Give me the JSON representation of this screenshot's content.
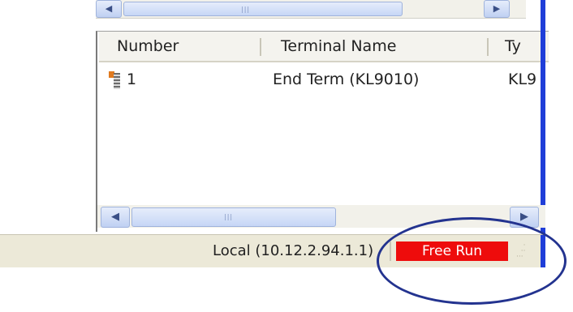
{
  "list": {
    "columns": [
      "Number",
      "Terminal Name",
      "Ty"
    ],
    "rows": [
      {
        "number": "1",
        "terminal_name": "End Term (KL9010)",
        "type": "KL9"
      }
    ]
  },
  "status_bar": {
    "connection": "Local (10.12.2.94.1.1)",
    "run_mode": "Free Run",
    "run_mode_color": "#ee0c0c"
  },
  "icons": {
    "terminal": "terminal-icon",
    "scroll_left": "arrow-left-icon",
    "scroll_right": "arrow-right-icon",
    "resize_grip": "resize-grip-icon"
  },
  "annotation": {
    "highlight_color": "#23338f"
  }
}
